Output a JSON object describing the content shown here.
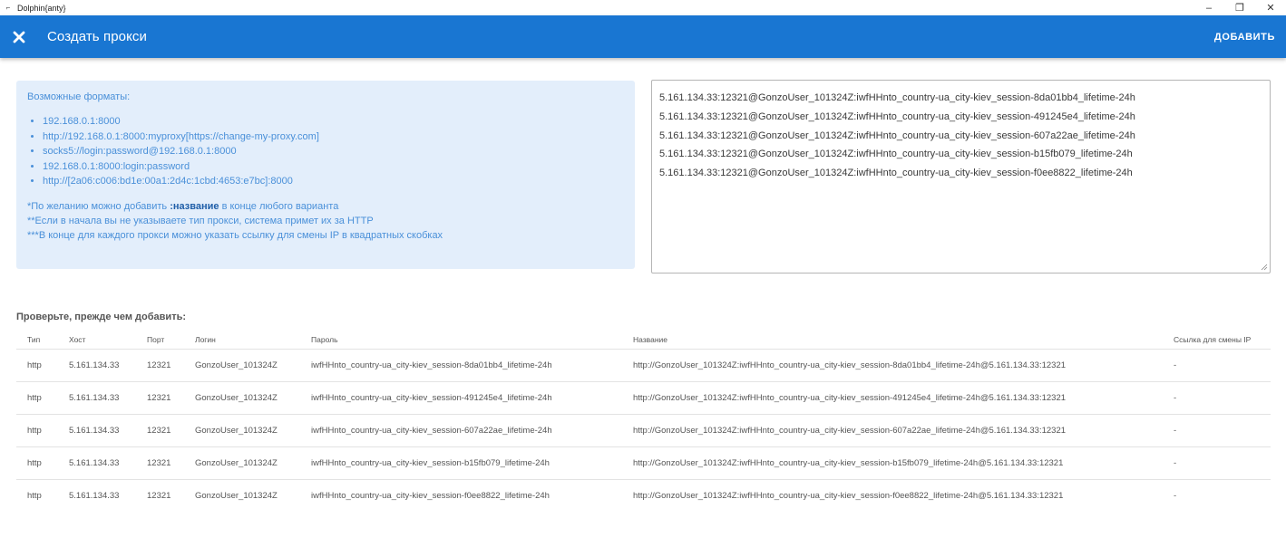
{
  "window": {
    "title": "Dolphin{anty}",
    "minimize": "–",
    "restore": "❐",
    "close": "✕"
  },
  "header": {
    "title": "Создать прокси",
    "add_label": "ДОБАВИТЬ"
  },
  "info": {
    "formats_title": "Возможные форматы:",
    "formats": [
      "192.168.0.1:8000",
      "http://192.168.0.1:8000:myproxy[https://change-my-proxy.com]",
      "socks5://login:password@192.168.0.1:8000",
      "192.168.0.1:8000:login:password",
      "http://[2a06:c006:bd1e:00a1:2d4c:1cbd:4653:e7bc]:8000"
    ],
    "note1_pre": "*По желанию можно добавить ",
    "note1_bold": ":название",
    "note1_post": " в конце любого варианта",
    "note2": "**Если в начала вы не указываете тип прокси, система примет их за HTTP",
    "note3": "***В конце для каждого прокси можно указать ссылку для смены IP в квадратных скобках"
  },
  "textarea": {
    "lines": [
      "5.161.134.33:12321@GonzoUser_101324Z:iwfHHnto_country-ua_city-kiev_session-8da01bb4_lifetime-24h",
      "5.161.134.33:12321@GonzoUser_101324Z:iwfHHnto_country-ua_city-kiev_session-491245e4_lifetime-24h",
      "5.161.134.33:12321@GonzoUser_101324Z:iwfHHnto_country-ua_city-kiev_session-607a22ae_lifetime-24h",
      "5.161.134.33:12321@GonzoUser_101324Z:iwfHHnto_country-ua_city-kiev_session-b15fb079_lifetime-24h",
      "5.161.134.33:12321@GonzoUser_101324Z:iwfHHnto_country-ua_city-kiev_session-f0ee8822_lifetime-24h"
    ]
  },
  "check": {
    "title": "Проверьте, прежде чем добавить:",
    "columns": [
      "Тип",
      "Хост",
      "Порт",
      "Логин",
      "Пароль",
      "Название",
      "Ссылка для смены IP"
    ],
    "rows": [
      [
        "http",
        "5.161.134.33",
        "12321",
        "GonzoUser_101324Z",
        "iwfHHnto_country-ua_city-kiev_session-8da01bb4_lifetime-24h",
        "http://GonzoUser_101324Z:iwfHHnto_country-ua_city-kiev_session-8da01bb4_lifetime-24h@5.161.134.33:12321",
        "-"
      ],
      [
        "http",
        "5.161.134.33",
        "12321",
        "GonzoUser_101324Z",
        "iwfHHnto_country-ua_city-kiev_session-491245e4_lifetime-24h",
        "http://GonzoUser_101324Z:iwfHHnto_country-ua_city-kiev_session-491245e4_lifetime-24h@5.161.134.33:12321",
        "-"
      ],
      [
        "http",
        "5.161.134.33",
        "12321",
        "GonzoUser_101324Z",
        "iwfHHnto_country-ua_city-kiev_session-607a22ae_lifetime-24h",
        "http://GonzoUser_101324Z:iwfHHnto_country-ua_city-kiev_session-607a22ae_lifetime-24h@5.161.134.33:12321",
        "-"
      ],
      [
        "http",
        "5.161.134.33",
        "12321",
        "GonzoUser_101324Z",
        "iwfHHnto_country-ua_city-kiev_session-b15fb079_lifetime-24h",
        "http://GonzoUser_101324Z:iwfHHnto_country-ua_city-kiev_session-b15fb079_lifetime-24h@5.161.134.33:12321",
        "-"
      ],
      [
        "http",
        "5.161.134.33",
        "12321",
        "GonzoUser_101324Z",
        "iwfHHnto_country-ua_city-kiev_session-f0ee8822_lifetime-24h",
        "http://GonzoUser_101324Z:iwfHHnto_country-ua_city-kiev_session-f0ee8822_lifetime-24h@5.161.134.33:12321",
        "-"
      ]
    ]
  },
  "colors": {
    "primary": "#1976d2",
    "info_bg": "#e3eefb",
    "info_text": "#4a90d9"
  }
}
